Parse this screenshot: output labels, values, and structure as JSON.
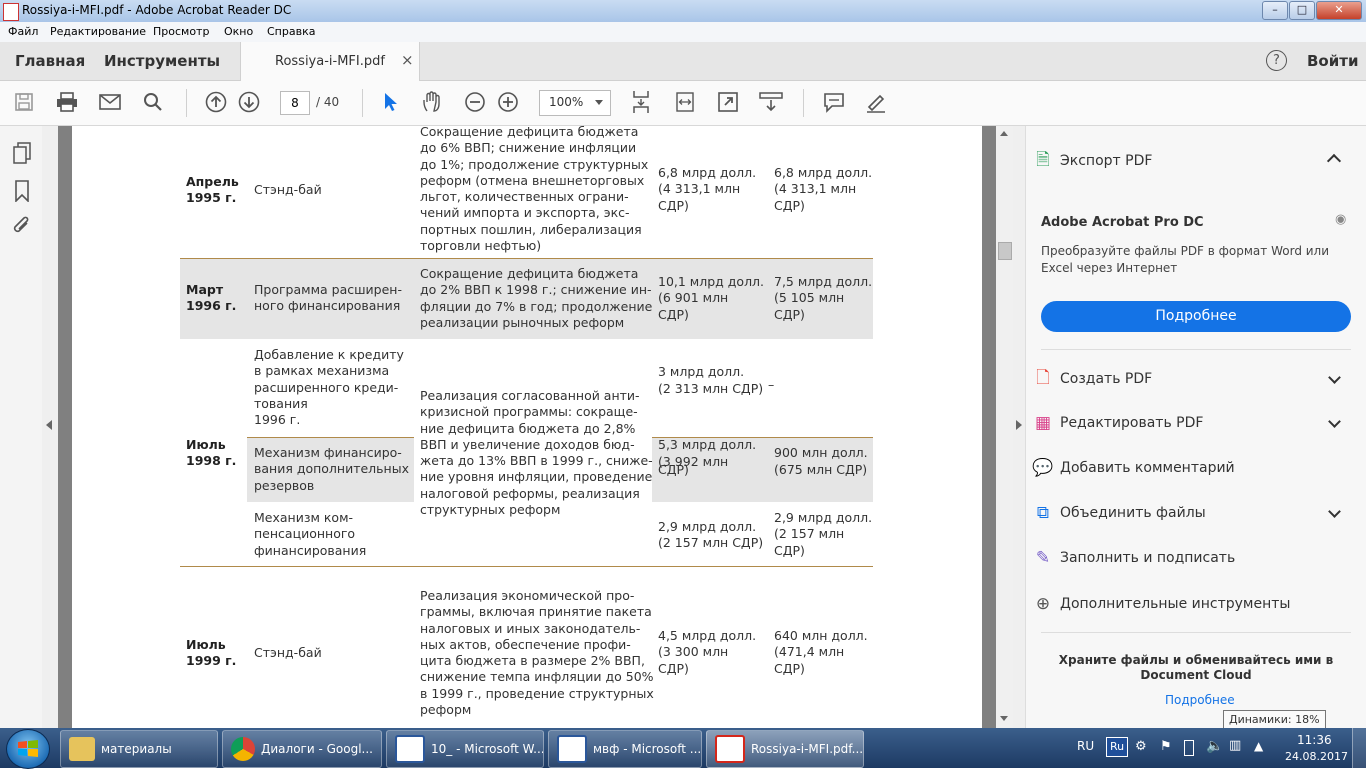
{
  "window": {
    "title": "Rossiya-i-MFI.pdf - Adobe Acrobat Reader DC",
    "controls": [
      "–",
      "□",
      "✕"
    ]
  },
  "menu": [
    "Файл",
    "Редактирование",
    "Просмотр",
    "Окно",
    "Справка"
  ],
  "nav": {
    "home": "Главная",
    "tools": "Инструменты",
    "doc_tab": "Rossiya-i-MFI.pdf",
    "close": "×",
    "help": "?",
    "signin": "Войти"
  },
  "toolbar": {
    "page_current": "8",
    "page_total": "/ 40",
    "zoom": "100%"
  },
  "table": {
    "r1": {
      "year": "Апрель\n1995 г.",
      "program": "Стэнд-бай",
      "conditions": "Сокращение дефицита бюджета\nдо 6% ВВП; снижение инфляции\nдо 1%; продолжение структурных\nреформ (отмена внешнеторговых\nльгот, количественных ограни-\nчений импорта и экспортa, экс-\nпортных пошлин, либерализация\nторговли нефтью)",
      "approved": "6,8 млрд долл.\n(4 313,1 млн\nСДР)",
      "received": "6,8 млрд долл.\n(4 313,1 млн\nСДР)"
    },
    "r2": {
      "year": "Март\n1996 г.",
      "program": "Программа расширен-\nного финансирования",
      "conditions": "Сокращение дефицита бюджета\nдо 2% ВВП к 1998 г.; снижение ин-\nфляции до 7% в год; продолжение\nреализации рыночных реформ",
      "approved": "10,1 млрд долл.\n(6 901 млн\nСДР)",
      "received": "7,5 млрд долл.\n(5 105 млн\nСДР)"
    },
    "r3": {
      "year": "Июль\n1998 г.",
      "program_a": "Добавление к кредиту\nв рамках механизма\nрасширенного креди-\nтования\n1996 г.",
      "program_b": "Механизм финансиро-\nвания дополнительных\nрезервов",
      "program_c": "Механизм ком-\nпенсационного\nфинансирования",
      "conditions": "Реализация согласованной анти-\nкризисной программы: сокраще-\nние дефицита бюджета до 2,8%\nВВП и увеличение доходов бюд-\nжета до 13% ВВП в 1999 г., сниже-\nние уровня инфляции, проведение\nналоговой реформы, реализация\nструктурных реформ",
      "approved_a": "3 млрд долл.\n\n(2 313 млн СДР)",
      "received_a": "–",
      "approved_b": "5,3 млрд долл.\n\n(3 992 млн\nСДР)",
      "received_b": "900 млн долл.\n\n(675 млн СДР)",
      "approved_c": "2,9 млрд долл.\n(2 157 млн СДР)",
      "received_c": "2,9 млрд долл.\n(2 157 млн\nСДР)"
    },
    "r4": {
      "year": "Июль\n1999 г.",
      "program": "Стэнд-бай",
      "conditions": "Реализация экономической про-\nграммы, включая принятие пакета\nналоговых и иных законодатель-\nных актов, обеспечение профи-\nцита бюджета в размере 2% ВВП,\nснижение темпа инфляции до 50%\nв 1999 г., проведение структурных\nреформ",
      "approved": "4,5 млрд долл.\n(3 300 млн\nСДР)",
      "received": "640 млн долл.\n(471,4 млн\nСДР)"
    }
  },
  "panel": {
    "export": "Экспорт PDF",
    "pro_title": "Adobe Acrobat Pro DC",
    "pro_desc": "Преобразуйте файлы PDF в формат Word или\nExcel через Интернет",
    "more_button": "Подробнее",
    "tools": [
      "Создать PDF",
      "Редактировать PDF",
      "Добавить комментарий",
      "Объединить файлы",
      "Заполнить и подписать",
      "Дополнительные инструменты"
    ],
    "cloud_text": "Храните файлы и обменивайтесь ими в\nDocument Cloud",
    "cloud_link": "Подробнее"
  },
  "tooltip": "Динамики: 18%",
  "taskbar": {
    "tasks": [
      "материалы",
      "Диалоги - Googl...",
      "10_ - Microsoft W...",
      "мвф - Microsoft ...",
      "Rossiya-i-MFI.pdf..."
    ],
    "lang": "RU",
    "lang_badge": "Ru",
    "time": "11:36",
    "date": "24.08.2017"
  },
  "colors": {
    "accent_blue": "#1473e6",
    "rule_gold": "#b08a4a",
    "band_gray": "#e5e5e5",
    "taskbar": "#1d3a63"
  }
}
